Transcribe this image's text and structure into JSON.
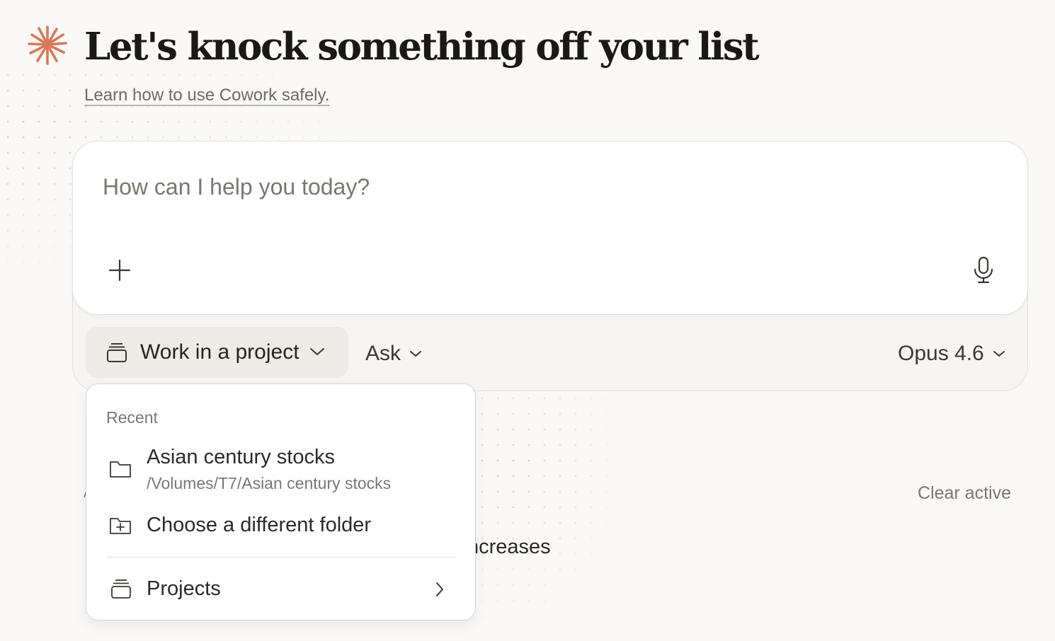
{
  "header": {
    "title": "Let's knock something off your list",
    "safety_link": "Learn how to use Cowork safely."
  },
  "composer": {
    "placeholder": "How can I help you today?"
  },
  "toolbar": {
    "project_label": "Work in a project",
    "mode_label": "Ask",
    "model_label": "Opus 4.6"
  },
  "dropdown": {
    "heading": "Recent",
    "recent_items": [
      {
        "name": "Asian century stocks",
        "path": "/Volumes/T7/Asian century stocks"
      }
    ],
    "choose_folder_label": "Choose a different folder",
    "projects_label": "Projects"
  },
  "background": {
    "clear_active_label": "Clear active",
    "partial_text": "ncreases"
  },
  "colors": {
    "accent": "#d97757",
    "page_bg": "#faf9f7",
    "card_bg": "#ffffff"
  },
  "icons": {
    "logo": "asterisk-burst-icon",
    "add": "plus-icon",
    "voice": "microphone-icon",
    "project": "project-stack-icon",
    "folder": "folder-icon",
    "new_folder": "folder-plus-icon",
    "chevron": "chevron-down-icon",
    "submenu": "chevron-right-icon"
  }
}
